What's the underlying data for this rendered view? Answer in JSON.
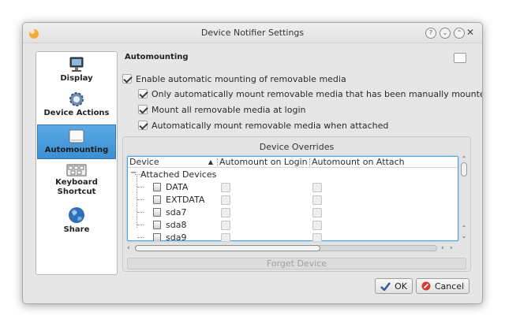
{
  "window": {
    "title": "Device Notifier Settings"
  },
  "sidebar": {
    "items": [
      {
        "label": "Display",
        "icon": "monitor-icon",
        "active": false
      },
      {
        "label": "Device Actions",
        "icon": "gear-icon",
        "active": false
      },
      {
        "label": "Automounting",
        "icon": "drive-icon",
        "active": true
      },
      {
        "label_line1": "Keyboard",
        "label_line2": "Shortcut",
        "icon": "keyboard-icon",
        "active": false
      },
      {
        "label": "Share",
        "icon": "globe-icon",
        "active": false
      }
    ]
  },
  "main": {
    "section_title": "Automounting",
    "options": [
      {
        "label": "Enable automatic mounting of removable media",
        "checked": true
      },
      {
        "label": "Only automatically mount removable media that has been manually mounted before",
        "checked": true
      },
      {
        "label": "Mount all removable media at login",
        "checked": true
      },
      {
        "label": "Automatically mount removable media when attached",
        "checked": true
      }
    ]
  },
  "overrides": {
    "title": "Device Overrides",
    "columns": [
      "Device",
      "Automount on Login",
      "Automount on Attach"
    ],
    "group_label": "Attached Devices",
    "devices": [
      {
        "name": "DATA",
        "login": false,
        "attach": false
      },
      {
        "name": "EXTDATA",
        "login": false,
        "attach": false
      },
      {
        "name": "sda7",
        "login": false,
        "attach": false
      },
      {
        "name": "sda8",
        "login": false,
        "attach": false
      },
      {
        "name": "sda9",
        "login": false,
        "attach": false
      }
    ],
    "forget_label": "Forget Device"
  },
  "buttons": {
    "ok": "OK",
    "cancel": "Cancel"
  },
  "colors": {
    "accent": "#3d8fd3",
    "focus": "#4aa3df"
  }
}
